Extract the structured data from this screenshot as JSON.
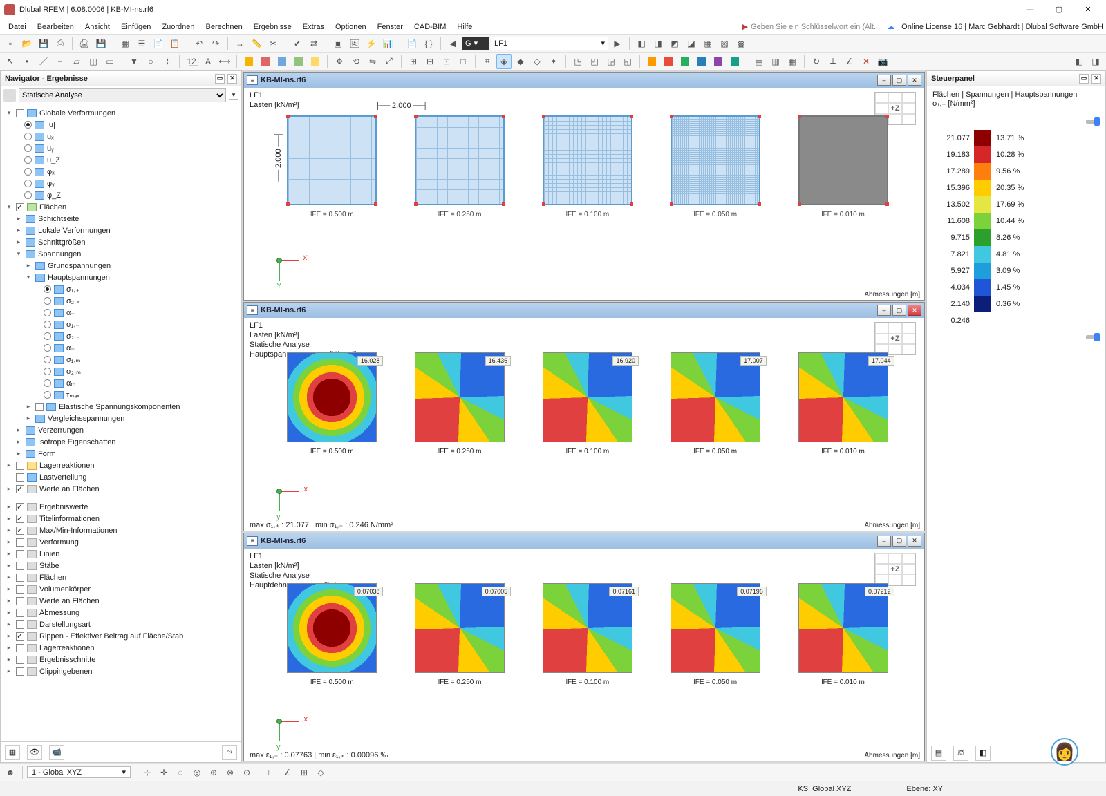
{
  "app": {
    "title": "Dlubal RFEM | 6.08.0006 | KB-MI-ns.rf6"
  },
  "menu": [
    "Datei",
    "Bearbeiten",
    "Ansicht",
    "Einfügen",
    "Zuordnen",
    "Berechnen",
    "Ergebnisse",
    "Extras",
    "Optionen",
    "Fenster",
    "CAD-BIM",
    "Hilfe"
  ],
  "hint": "Geben Sie ein Schlüsselwort ein (Alt...",
  "license": "Online License 16 | Marc Gebhardt | Dlubal Software GmbH",
  "toolbar1": {
    "combo_g": "G",
    "combo_lf": "LF1"
  },
  "nav": {
    "title": "Navigator - Ergebnisse",
    "filter": "Statische Analyse",
    "group_globale": "Globale Verformungen",
    "radios_def": [
      "|u|",
      "uₓ",
      "uᵧ",
      "u_Z",
      "φₓ",
      "φᵧ",
      "φ_Z"
    ],
    "group_flaechen": "Flächen",
    "fl_children": [
      "Schichtseite",
      "Lokale Verformungen",
      "Schnittgrößen",
      "Spannungen"
    ],
    "sp_children": [
      "Grundspannungen",
      "Hauptspannungen"
    ],
    "hp_radios": [
      "σ₁,₊",
      "σ₂,₊",
      "α₊",
      "σ₁,₋",
      "σ₂,₋",
      "α₋",
      "σ₁,ₘ",
      "σ₂,ₘ",
      "αₘ",
      "τₘₐₓ"
    ],
    "fl_tail": [
      "Elastische Spannungskomponenten",
      "Vergleichsspannungen",
      "Verzerrungen",
      "Isotrope Eigenschaften",
      "Form"
    ],
    "root_tail": [
      "Lagerreaktionen",
      "Lastverteilung",
      "Werte an Flächen"
    ],
    "block2": [
      "Ergebniswerte",
      "Titelinformationen",
      "Max/Min-Informationen",
      "Verformung",
      "Linien",
      "Stäbe",
      "Flächen",
      "Volumenkörper",
      "Werte an Flächen",
      "Abmessung",
      "Darstellungsart",
      "Rippen - Effektiver Beitrag auf Fläche/Stab",
      "Lagerreaktionen",
      "Ergebnisschnitte",
      "Clippingebenen"
    ],
    "block2_checked": [
      0,
      1,
      2,
      11
    ]
  },
  "views": {
    "file": "KB-MI-ns.rf6",
    "v1": {
      "lines": [
        "LF1",
        "Lasten [kN/m²]"
      ],
      "dim_w": "2.000",
      "dim_h": "2.000",
      "foot": "Abmessungen [m]",
      "meshes": [
        "lFE = 0.500 m",
        "lFE = 0.250 m",
        "lFE = 0.100 m",
        "lFE = 0.050 m",
        "lFE = 0.010 m"
      ]
    },
    "v2": {
      "lines": [
        "LF1",
        "Lasten [kN/m²]",
        "Statische Analyse",
        "Hauptspannungen σ₁,₊ [N/mm²]"
      ],
      "vals": [
        "16.028",
        "16.436",
        "16.920",
        "17.007",
        "17.044"
      ],
      "caps": [
        "lFE = 0.500 m",
        "lFE = 0.250 m",
        "lFE = 0.100 m",
        "lFE = 0.050 m",
        "lFE = 0.010 m"
      ],
      "summary": "max σ₁,₊ : 21.077 | min σ₁,₊ : 0.246 N/mm²",
      "foot": "Abmessungen [m]"
    },
    "v3": {
      "lines": [
        "LF1",
        "Lasten [kN/m²]",
        "Statische Analyse",
        "Hauptdehnungen ε₁,₊ [‰]"
      ],
      "vals": [
        "0.07038",
        "0.07005",
        "0.07161",
        "0.07196",
        "0.07212"
      ],
      "caps": [
        "lFE = 0.500 m",
        "lFE = 0.250 m",
        "lFE = 0.100 m",
        "lFE = 0.050 m",
        "lFE = 0.010 m"
      ],
      "summary": "max ε₁,₊ : 0.07763 | min ε₁,₊ : 0.00096 ‰",
      "foot": "Abmessungen [m]"
    },
    "cube": "+Z"
  },
  "steuer": {
    "title": "Steuerpanel",
    "heading": "Flächen | Spannungen | Hauptspannungen",
    "sub": "σ₁,₊ [N/mm²]",
    "rows": [
      {
        "v": "21.077",
        "c": "#8e0000",
        "p": "13.71 %"
      },
      {
        "v": "19.183",
        "c": "#d62728",
        "p": "10.28 %"
      },
      {
        "v": "17.289",
        "c": "#ff7f0e",
        "p": "9.56 %"
      },
      {
        "v": "15.396",
        "c": "#ffcc00",
        "p": "20.35 %"
      },
      {
        "v": "13.502",
        "c": "#e6e642",
        "p": "17.69 %"
      },
      {
        "v": "11.608",
        "c": "#7bd23a",
        "p": "10.44 %"
      },
      {
        "v": "9.715",
        "c": "#2ca02c",
        "p": "8.26 %"
      },
      {
        "v": "7.821",
        "c": "#40c8e0",
        "p": "4.81 %"
      },
      {
        "v": "5.927",
        "c": "#1f9ede",
        "p": "3.09 %"
      },
      {
        "v": "4.034",
        "c": "#1f55d6",
        "p": "1.45 %"
      },
      {
        "v": "2.140",
        "c": "#0b1e7a",
        "p": "0.36 %"
      },
      {
        "v": "0.246",
        "c": "",
        "p": ""
      }
    ]
  },
  "statusbar": {
    "cs_combo": "1 - Global XYZ",
    "ks": "KS: Global XYZ",
    "ebene": "Ebene: XY"
  },
  "chart_data": {
    "type": "table",
    "title": "Flächen | Spannungen | Hauptspannungen σ₁,₊ [N/mm²]",
    "legend_values": [
      21.077,
      19.183,
      17.289,
      15.396,
      13.502,
      11.608,
      9.715,
      7.821,
      5.927,
      4.034,
      2.14,
      0.246
    ],
    "legend_percent": [
      13.71,
      10.28,
      9.56,
      20.35,
      17.69,
      10.44,
      8.26,
      4.81,
      3.09,
      1.45,
      0.36
    ],
    "mesh_sizes_m": [
      0.5,
      0.25,
      0.1,
      0.05,
      0.01
    ],
    "sigma1_plus_at_probe": [
      16.028,
      16.436,
      16.92,
      17.007,
      17.044
    ],
    "eps1_plus_at_probe_permille": [
      0.07038,
      0.07005,
      0.07161,
      0.07196,
      0.07212
    ],
    "sigma1_plus_max": 21.077,
    "sigma1_plus_min": 0.246,
    "eps1_plus_max": 0.07763,
    "eps1_plus_min": 0.00096
  }
}
